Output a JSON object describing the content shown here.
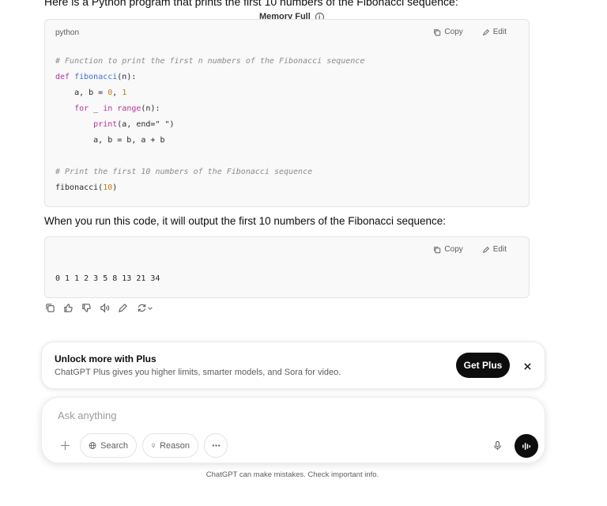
{
  "conversation": {
    "intro_text": "Here is a Python program that prints the first 10 numbers of the Fibonacci sequence:",
    "memory_label": "Memory Full",
    "code_block_1": {
      "language": "python",
      "copy_label": "Copy",
      "edit_label": "Edit"
    },
    "middle_text": "When you run this code, it will output the first 10 numbers of the Fibonacci sequence:",
    "code_block_2": {
      "copy_label": "Copy",
      "edit_label": "Edit",
      "output": "0 1 1 2 3 5 8 13 21 34"
    }
  },
  "upsell": {
    "title": "Unlock more with Plus",
    "subtitle": "ChatGPT Plus gives you higher limits, smarter models, and Sora for video.",
    "button_label": "Get Plus"
  },
  "composer": {
    "placeholder": "Ask anything",
    "search_label": "Search",
    "reason_label": "Reason"
  },
  "footer": {
    "disclaimer": "ChatGPT can make mistakes. Check important info."
  }
}
